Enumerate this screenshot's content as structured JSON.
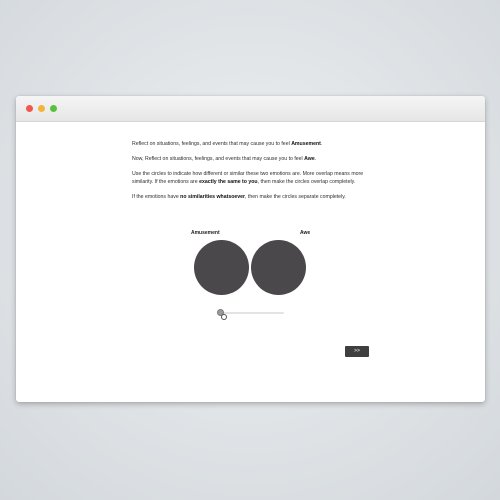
{
  "window": {
    "controls": [
      "close",
      "minimize",
      "maximize"
    ],
    "colors": {
      "close": "#f0574e",
      "minimize": "#f2b43a",
      "maximize": "#58c23c"
    }
  },
  "instructions": {
    "p1_before": "Reflect on situations, feelings, and events that may cause you to feel ",
    "p1_bold": "Amusement",
    "p1_after": ".",
    "p2_before": "Now, Reflect on situations, feelings, and events that may cause you to feel ",
    "p2_bold": "Awe",
    "p2_after": ".",
    "p3_before": "Use the circles to indicate how different or similar these two emotions are. More overlap means more similarity. If the emotions are ",
    "p3_bold": "exactly the same to you",
    "p3_after": ", then make the circles overlap completely.",
    "p4_before": "If the emotions have ",
    "p4_bold": "no similarities whatsoever",
    "p4_after": ", then make the circles separate completely."
  },
  "circles": {
    "left_label": "Amusement",
    "right_label": "Awe",
    "color": "#4b484c"
  },
  "slider": {
    "value": 0
  },
  "next_button": {
    "label": ">>"
  }
}
